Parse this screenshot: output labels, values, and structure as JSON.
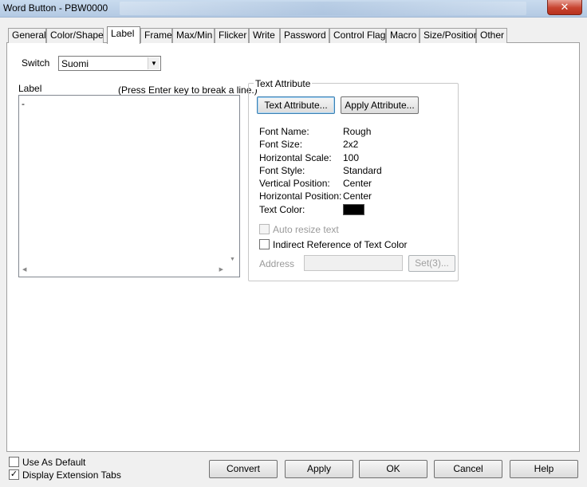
{
  "window": {
    "title": "Word Button - PBW0000",
    "close_label": "✕"
  },
  "tabs": [
    {
      "label": "General"
    },
    {
      "label": "Color/Shape"
    },
    {
      "label": "Label"
    },
    {
      "label": "Frame"
    },
    {
      "label": "Max/Min"
    },
    {
      "label": "Flicker"
    },
    {
      "label": "Write"
    },
    {
      "label": "Password"
    },
    {
      "label": "Control Flag"
    },
    {
      "label": "Macro"
    },
    {
      "label": "Size/Position"
    },
    {
      "label": "Other"
    }
  ],
  "active_tab": "Label",
  "switch": {
    "label": "Switch",
    "value": "Suomi",
    "arrow": "▼"
  },
  "label_section": {
    "label": "Label",
    "hint": "(Press Enter key to break a line.)",
    "text": "-",
    "scroll_down": "▼",
    "scroll_left": "◀",
    "scroll_right": "▶"
  },
  "text_attribute": {
    "group_title": "Text Attribute",
    "text_attribute_button": "Text Attribute...",
    "apply_attribute_button": "Apply Attribute...",
    "properties": [
      {
        "name": "Font Name:",
        "value": "Rough"
      },
      {
        "name": "Font Size:",
        "value": "2x2"
      },
      {
        "name": "Horizontal Scale:",
        "value": "100"
      },
      {
        "name": "Font Style:",
        "value": "Standard"
      },
      {
        "name": "Vertical Position:",
        "value": "Center"
      },
      {
        "name": "Horizontal Position:",
        "value": "Center"
      }
    ],
    "text_color_label": "Text Color:",
    "text_color": "#000000",
    "auto_resize": {
      "label": "Auto resize text",
      "checked": false
    },
    "indirect_reference": {
      "label": "Indirect Reference of Text Color",
      "checked": false
    },
    "address_label": "Address",
    "address_value": "",
    "set_button": "Set(3)..."
  },
  "footer": {
    "use_as_default": {
      "label": "Use As Default",
      "checked": false
    },
    "display_extension_tabs": {
      "label": "Display Extension Tabs",
      "checked": true,
      "mark": "✓"
    },
    "buttons": {
      "convert": "Convert",
      "apply": "Apply",
      "ok": "OK",
      "cancel": "Cancel",
      "help": "Help"
    }
  }
}
